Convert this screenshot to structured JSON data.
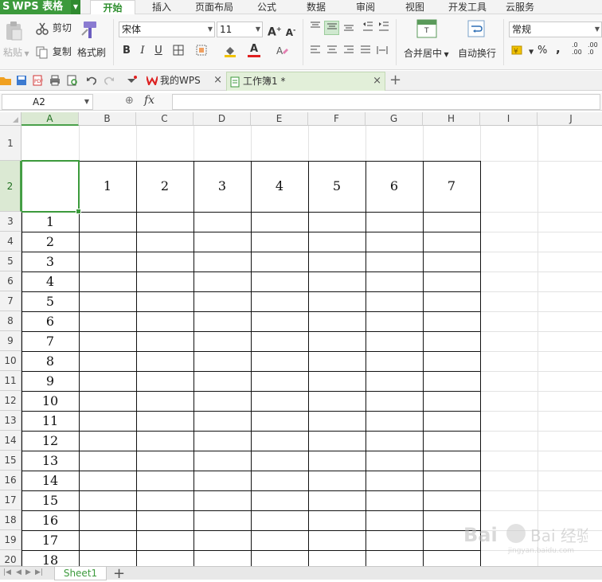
{
  "app": {
    "name": "WPS 表格",
    "logo_glyph": "S"
  },
  "menu_tabs": [
    {
      "label": "开始",
      "active": true
    },
    {
      "label": "插入",
      "active": false
    },
    {
      "label": "页面布局",
      "active": false
    },
    {
      "label": "公式",
      "active": false
    },
    {
      "label": "数据",
      "active": false
    },
    {
      "label": "审阅",
      "active": false
    },
    {
      "label": "视图",
      "active": false
    },
    {
      "label": "开发工具",
      "active": false
    },
    {
      "label": "云服务",
      "active": false
    }
  ],
  "ribbon": {
    "paste_label": "粘贴",
    "cut_label": "剪切",
    "copy_label": "复制",
    "format_painter_label": "格式刷",
    "font_name": "宋体",
    "font_size": "11",
    "merge_center_label": "合并居中",
    "wrap_text_label": "自动换行",
    "number_format": "常规",
    "percent_symbol": "%",
    "bold_glyph": "B",
    "italic_glyph": "I",
    "underline_glyph": "U",
    "increase_font_glyph": "A",
    "decrease_font_glyph": "A",
    "font_color_glyph": "A",
    "comma_glyph": ",",
    "inc_decimal_glyph": ".0 .00",
    "dec_decimal_glyph": ".00 .0",
    "accent_color": "#3c9a3c",
    "font_color": "#e02020",
    "fill_color": "#f2c300"
  },
  "doc_tabs": [
    {
      "label": "我的WPS",
      "active": false,
      "close": "×"
    },
    {
      "label": "工作簿1 *",
      "active": true,
      "close": "×"
    }
  ],
  "new_tab_glyph": "+",
  "formula_bar": {
    "name_box": "A2",
    "fx_label": "fx",
    "formula": ""
  },
  "columns": [
    "A",
    "B",
    "C",
    "D",
    "E",
    "F",
    "G",
    "H",
    "I",
    "J"
  ],
  "rows": [
    "1",
    "2",
    "3",
    "4",
    "5",
    "6",
    "7",
    "8",
    "9",
    "10",
    "11",
    "12",
    "13",
    "14",
    "15",
    "16",
    "17",
    "18",
    "19",
    "20"
  ],
  "selected_cell": "A2",
  "header_row_values": [
    "",
    "1",
    "2",
    "3",
    "4",
    "5",
    "6",
    "7"
  ],
  "column_a_values": [
    "1",
    "2",
    "3",
    "4",
    "5",
    "6",
    "7",
    "8",
    "9",
    "10",
    "11",
    "12",
    "13",
    "14",
    "15",
    "16",
    "17",
    "18"
  ],
  "sheet_tabs": [
    {
      "label": "Sheet1",
      "active": true
    }
  ],
  "add_sheet_glyph": "+",
  "watermark": {
    "text": "Bai 经验",
    "sub": "jingyan.baidu.com"
  }
}
